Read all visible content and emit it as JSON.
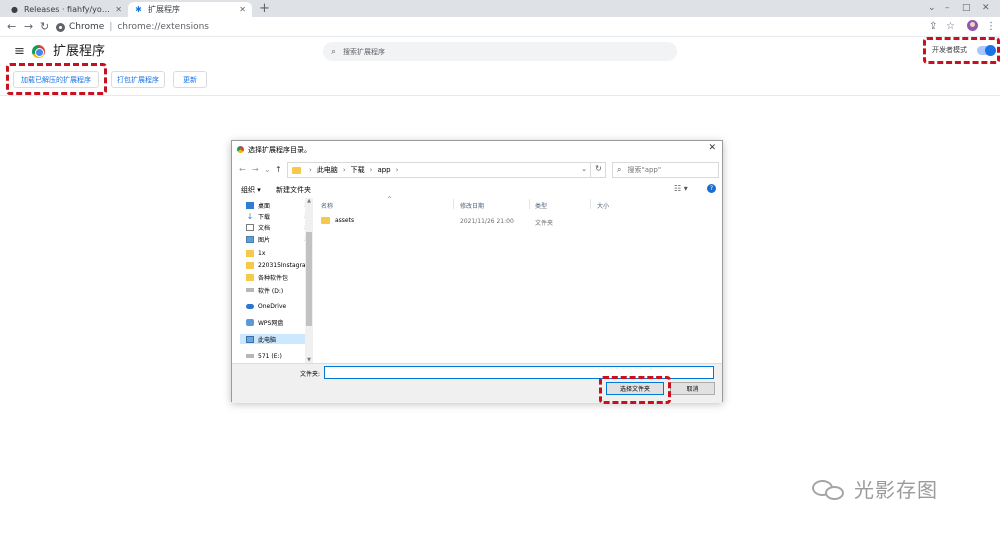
{
  "tabs": [
    {
      "label": "Releases · fiahfy/youtube-live",
      "icon": "github-icon"
    },
    {
      "label": "扩展程序",
      "icon": "puzzle-icon"
    }
  ],
  "window_controls": [
    "–",
    "□",
    "✕"
  ],
  "omnibox": {
    "chip": "Chrome",
    "url": "chrome://extensions"
  },
  "extensions": {
    "title": "扩展程序",
    "search_placeholder": "搜索扩展程序",
    "dev_mode_label": "开发者模式",
    "dev_mode_on": true,
    "buttons": {
      "load": "加载已解压的扩展程序",
      "pack": "打包扩展程序",
      "update": "更新"
    }
  },
  "dialog": {
    "title": "选择扩展程序目录。",
    "breadcrumb": [
      "此电脑",
      "下载",
      "app"
    ],
    "search_placeholder": "搜索\"app\"",
    "commands": {
      "organize": "组织 ▾",
      "new_folder": "新建文件夹"
    },
    "nav_items": [
      {
        "label": "桌面",
        "icon": "desktop-icon",
        "pinned": true
      },
      {
        "label": "下载",
        "icon": "download-icon",
        "pinned": true
      },
      {
        "label": "文档",
        "icon": "document-icon",
        "pinned": true
      },
      {
        "label": "图片",
        "icon": "picture-icon",
        "pinned": true
      },
      {
        "label": "1x",
        "icon": "folder-icon",
        "pinned": false
      },
      {
        "label": "220315Instagra",
        "icon": "folder-icon",
        "pinned": false
      },
      {
        "label": "各种软件包",
        "icon": "folder-icon",
        "pinned": false
      },
      {
        "label": "软件 (D:)",
        "icon": "drive-icon",
        "pinned": false
      },
      {
        "label": "OneDrive",
        "icon": "cloud-icon",
        "pinned": false
      },
      {
        "label": "WPS网盘",
        "icon": "wps-icon",
        "pinned": false
      },
      {
        "label": "此电脑",
        "icon": "computer-icon",
        "pinned": false,
        "selected": true
      },
      {
        "label": "571 (E:)",
        "icon": "drive-icon",
        "pinned": false
      }
    ],
    "columns": [
      "名称",
      "修改日期",
      "类型",
      "大小"
    ],
    "files": [
      {
        "name": "assets",
        "modified": "2021/11/26 21:00",
        "type": "文件夹",
        "size": ""
      }
    ],
    "filename_label": "文件夹:",
    "filename_value": "",
    "select_button": "选择文件夹",
    "cancel_button": "取消"
  },
  "watermark": "光影存图",
  "colors": {
    "accent": "#1a73e8",
    "highlight": "#c8101e",
    "tabstrip": "#dee1e6"
  }
}
